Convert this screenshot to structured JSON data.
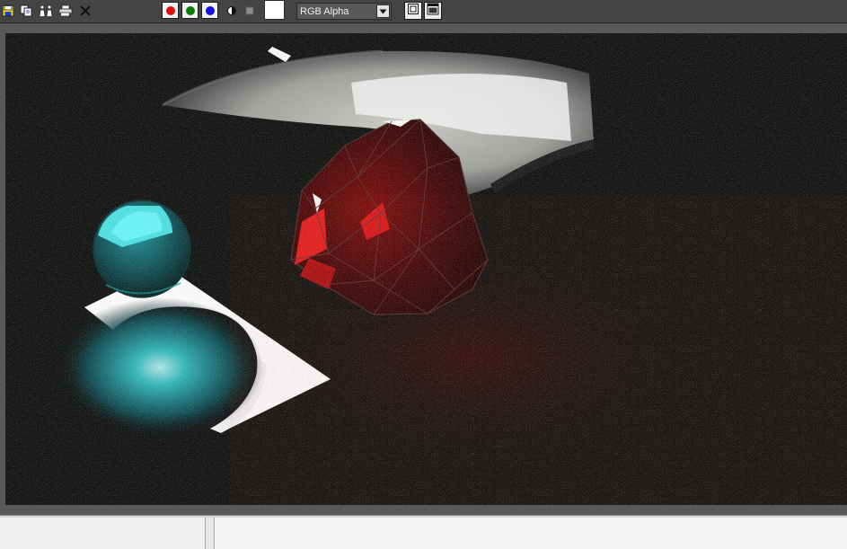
{
  "toolbar": {
    "tools": [
      {
        "name": "save-image",
        "icon": "floppy-disk-icon"
      },
      {
        "name": "copy-image",
        "icon": "copy-icon"
      },
      {
        "name": "clone-window",
        "icon": "clone-icon"
      },
      {
        "name": "print-image",
        "icon": "printer-icon"
      },
      {
        "name": "clear-image",
        "icon": "x-close-icon"
      }
    ],
    "channels": [
      {
        "name": "red-channel",
        "color": "#e01010"
      },
      {
        "name": "green-channel",
        "color": "#0a7a0a"
      },
      {
        "name": "blue-channel",
        "color": "#1010e0"
      }
    ],
    "display_channel": {
      "selected": "RGB Alpha"
    },
    "swatch_color": "#ffffff"
  },
  "render": {
    "background_color": "#0f110f",
    "sphere_color": "#1fb8bd",
    "gem_color": "#b01010"
  }
}
